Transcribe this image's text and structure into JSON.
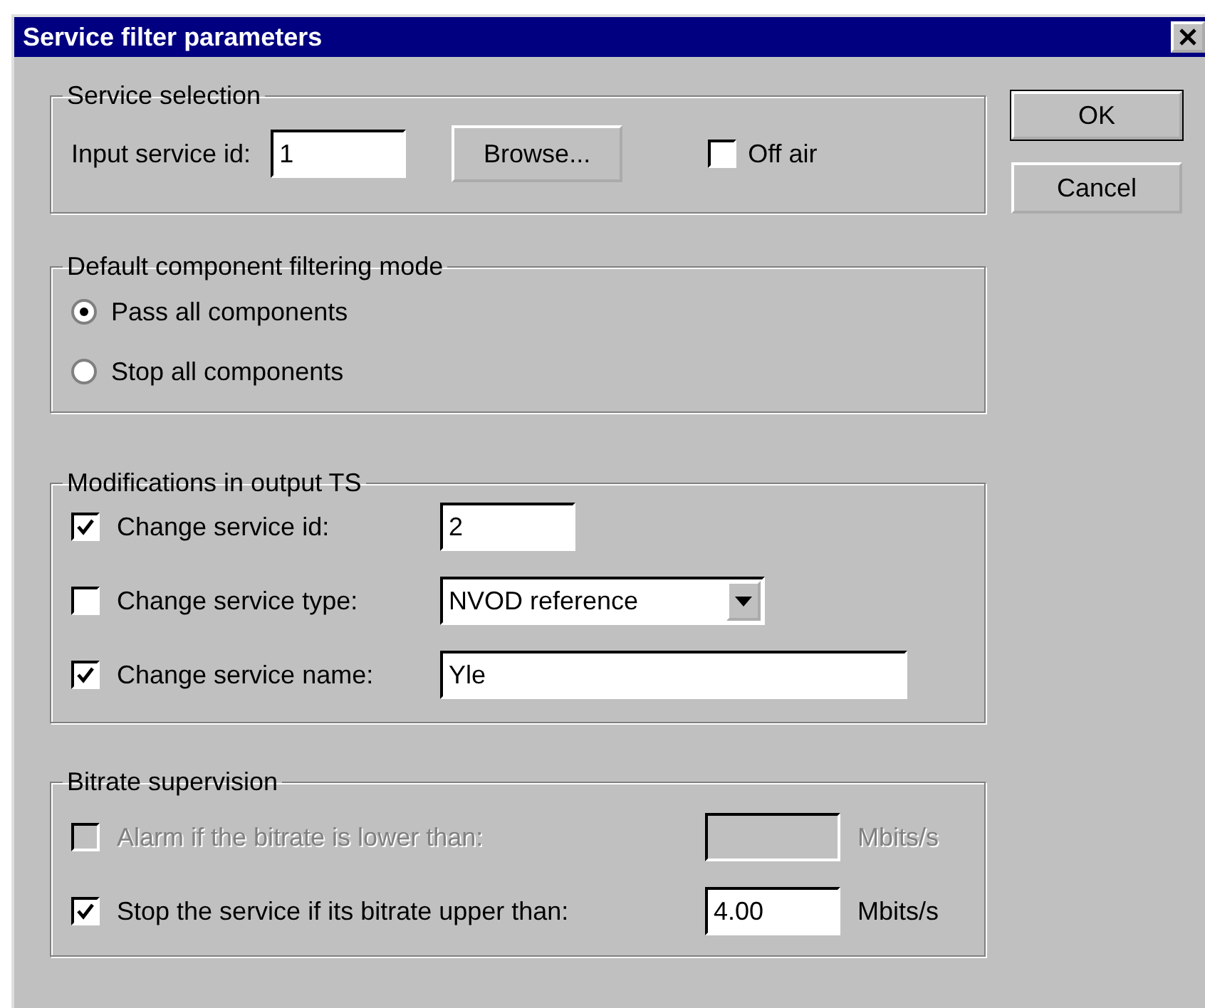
{
  "window": {
    "title": "Service filter parameters"
  },
  "service_selection": {
    "title": "Service selection",
    "input_label": "Input service id:",
    "input_value": "1",
    "browse_button": "Browse...",
    "off_air": {
      "label": "Off air",
      "checked": false
    }
  },
  "filtering_mode": {
    "title": "Default component filtering mode",
    "options": [
      {
        "label": "Pass all components",
        "selected": true
      },
      {
        "label": "Stop all components",
        "selected": false
      }
    ]
  },
  "modifications": {
    "title": "Modifications in output TS",
    "rows": [
      {
        "kind": "text",
        "label": "Change service id:",
        "checked": true,
        "value": "2"
      },
      {
        "kind": "select",
        "label": "Change service type:",
        "checked": false,
        "value": "NVOD reference"
      },
      {
        "kind": "wide",
        "label": "Change service name:",
        "checked": true,
        "value": "Yle"
      }
    ]
  },
  "bitrate": {
    "title": "Bitrate supervision",
    "rows": [
      {
        "label": "Alarm if the bitrate is lower than:",
        "checked": false,
        "disabled": true,
        "unit": "Mbits/s"
      },
      {
        "label": "Stop the service if its bitrate upper than:",
        "checked": true,
        "disabled": false,
        "value": "4.00",
        "unit": "Mbits/s"
      }
    ]
  },
  "buttons": [
    "OK",
    "Cancel"
  ]
}
